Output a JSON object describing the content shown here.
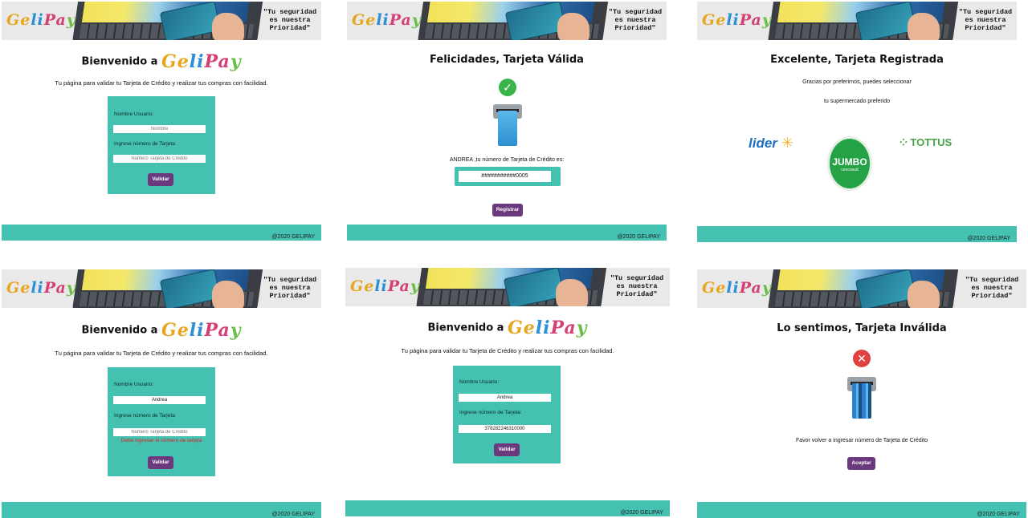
{
  "banner": {
    "logo_parts": [
      "Ge",
      "li",
      "Pa",
      "y"
    ],
    "slogan": "\"Tu seguridad es nuestra Prioridad\""
  },
  "footer": {
    "text": "@2020 GELIPAY"
  },
  "welcome": {
    "title_prefix": "Bienvenido a",
    "title_logo": "GeliPay",
    "subtitle": "Tu página para validar tu Tarjeta de Crédito y realizar tus compras con facilidad.",
    "username_label": "Nombre Usuario:",
    "username_placeholder": "Nombre",
    "card_label": "Ingrese número de Tarjeta:",
    "card_placeholder": "Número Tarjeta de Crédito",
    "validate_button": "Validar"
  },
  "valid": {
    "title": "Felicidades, Tarjeta Válida",
    "message": "ANDREA ,tu número de Tarjeta de Crédito es:",
    "masked_number": "###########0005",
    "register_button": "Registrar"
  },
  "registered": {
    "title": "Excelente, Tarjeta Registrada",
    "line1": "Gracias por preferirnos, puedes seleccionar",
    "line2": "tu supermercado preferido",
    "store_lider": "lider",
    "store_jumbo": "JUMBO",
    "store_jumbo_sub": "cencosud",
    "store_tottus": "TOTTUS"
  },
  "error_form": {
    "username_value": "Andrea",
    "error_text": "Debe ingresar el número de tarjeta"
  },
  "filled_form": {
    "username_value": "Andrea",
    "card_value": "378282246310000"
  },
  "invalid": {
    "title": "Lo sentimos, Tarjeta Inválida",
    "message": "Favor volver a ingresar número de Tarjeta de Crédito",
    "accept_button": "Aceptar"
  },
  "colors": {
    "teal": "#45c1b1",
    "purple": "#6b3a7e",
    "success": "#3bb54a",
    "error": "#e0403f"
  },
  "icons": [
    "check-icon",
    "error-x-icon",
    "atm-card-icon"
  ]
}
